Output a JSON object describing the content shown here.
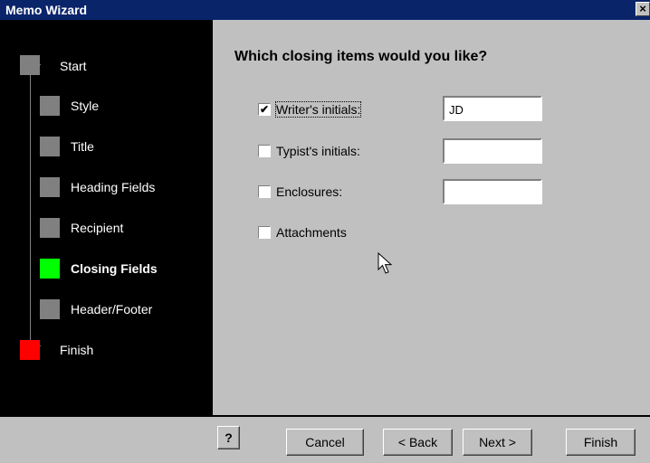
{
  "window": {
    "title": "Memo Wizard",
    "close_glyph": "×"
  },
  "steps": [
    {
      "label": "Start",
      "color": "#808080"
    },
    {
      "label": "Style",
      "color": "#808080"
    },
    {
      "label": "Title",
      "color": "#808080"
    },
    {
      "label": "Heading Fields",
      "color": "#808080"
    },
    {
      "label": "Recipient",
      "color": "#808080"
    },
    {
      "label": "Closing Fields",
      "color": "#00ff00",
      "current": true
    },
    {
      "label": "Header/Footer",
      "color": "#808080"
    },
    {
      "label": "Finish",
      "color": "#ff0000"
    }
  ],
  "main": {
    "heading": "Which closing items would you like?",
    "options": [
      {
        "label": "Writer's initials:",
        "checked": true,
        "value": "JD",
        "has_text": true
      },
      {
        "label": "Typist's initials:",
        "checked": false,
        "value": "",
        "has_text": true
      },
      {
        "label": "Enclosures:",
        "checked": false,
        "value": "",
        "has_text": true
      },
      {
        "label": "Attachments",
        "checked": false,
        "has_text": false
      }
    ]
  },
  "buttons": {
    "help": "?",
    "cancel": "Cancel",
    "back": "< Back",
    "next": "Next >",
    "finish": "Finish"
  },
  "colors": {
    "titlebar": "#0a246a",
    "panel": "#000000",
    "face": "#c0c0c0"
  }
}
